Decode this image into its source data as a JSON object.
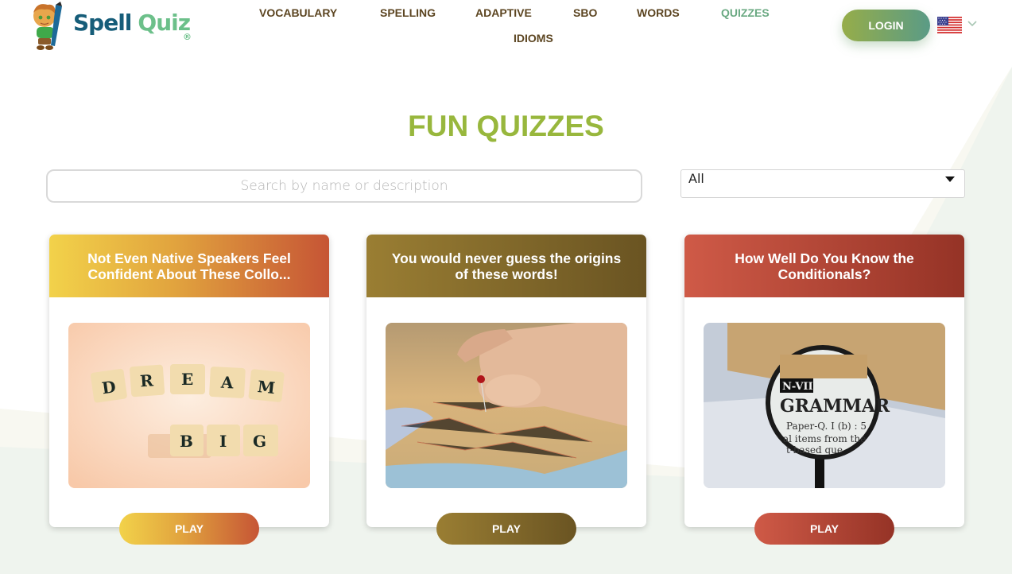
{
  "header": {
    "logo": {
      "word1": "Spell",
      "word2": "Quiz",
      "reg": "®"
    },
    "nav": [
      {
        "label": "VOCABULARY",
        "active": false
      },
      {
        "label": "SPELLING",
        "active": false
      },
      {
        "label": "ADAPTIVE",
        "active": false
      },
      {
        "label": "SBO",
        "active": false
      },
      {
        "label": "WORDS",
        "active": false
      },
      {
        "label": "QUIZZES",
        "active": true
      },
      {
        "label": "IDIOMS",
        "active": false
      }
    ],
    "login_label": "LOGIN",
    "language": {
      "flag_icon": "us-flag-icon",
      "chevron_icon": "chevron-down-icon"
    }
  },
  "main": {
    "title": "FUN QUIZZES",
    "search": {
      "placeholder": "Search by name or description",
      "value": ""
    },
    "filter": {
      "selected": "All"
    },
    "cards": [
      {
        "title": "Not Even Native Speakers Feel Confident About These Collo...",
        "image": "Scrabble tiles spelling DREAM BIG",
        "play_label": "PLAY",
        "gradient": [
          "#f2d24a",
          "#c65535"
        ]
      },
      {
        "title": "You would never guess the origins of these words!",
        "image": "Hand placing a red pin on a map",
        "play_label": "PLAY",
        "gradient": [
          "#9a7e33",
          "#6a5422"
        ]
      },
      {
        "title": "How Well Do You Know the Conditionals?",
        "image": "Magnifying glass over the word GRAMMAR",
        "play_label": "PLAY",
        "gradient": [
          "#cf5a47",
          "#953326"
        ]
      }
    ]
  },
  "colors": {
    "title_green": "#98b73d",
    "nav_brown": "#5c4521",
    "nav_active": "#6aa982",
    "login_gradient": [
      "#96ad49",
      "#5a9b86"
    ],
    "background": "#eff4ee"
  }
}
